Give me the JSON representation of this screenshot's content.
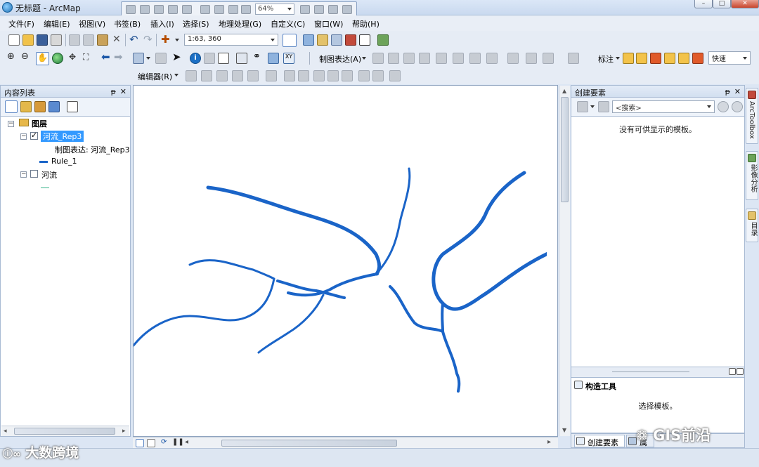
{
  "app": {
    "title": "无标题 - ArcMap"
  },
  "quick_toolbar": {
    "zoom": "64%"
  },
  "window_controls": {
    "minimize": "–",
    "maximize": "□",
    "close": "✕"
  },
  "menu": {
    "items": [
      "文件(F)",
      "编辑(E)",
      "视图(V)",
      "书签(B)",
      "插入(I)",
      "选择(S)",
      "地理处理(G)",
      "自定义(C)",
      "窗口(W)",
      "帮助(H)"
    ]
  },
  "toolbar1": {
    "scale": "1:63, 360"
  },
  "toolbar2": {
    "representation_label": "制图表达(A)",
    "annotation_label": "标注",
    "speed": "快速"
  },
  "toolbar3": {
    "editor_label": "编辑器(R)"
  },
  "toc": {
    "title": "内容列表",
    "pin": "ᵽ",
    "close": "✕",
    "root": "图层",
    "layer1": {
      "name": "河流_Rep3",
      "checked": true,
      "representation": "制图表达: 河流_Rep3",
      "rule": "Rule_1"
    },
    "layer2": {
      "name": "河流",
      "checked": false
    }
  },
  "create_features": {
    "title": "创建要素",
    "search_placeholder": "<搜索>",
    "empty_message": "没有可供显示的模板。"
  },
  "construct_tools": {
    "title": "构造工具",
    "message": "选择模板。"
  },
  "bottom_tabs": {
    "create": "创建要素",
    "other": "属"
  },
  "right_strip": {
    "toolbox": "ArcToolbox",
    "image": "影像分析",
    "catalog": "目录"
  },
  "watermarks": {
    "left": "大数跨境",
    "right": "GIS前沿"
  },
  "colors": {
    "river": "#1a64c8",
    "selection": "#3399ff",
    "window_bg": "#dce6f4"
  }
}
